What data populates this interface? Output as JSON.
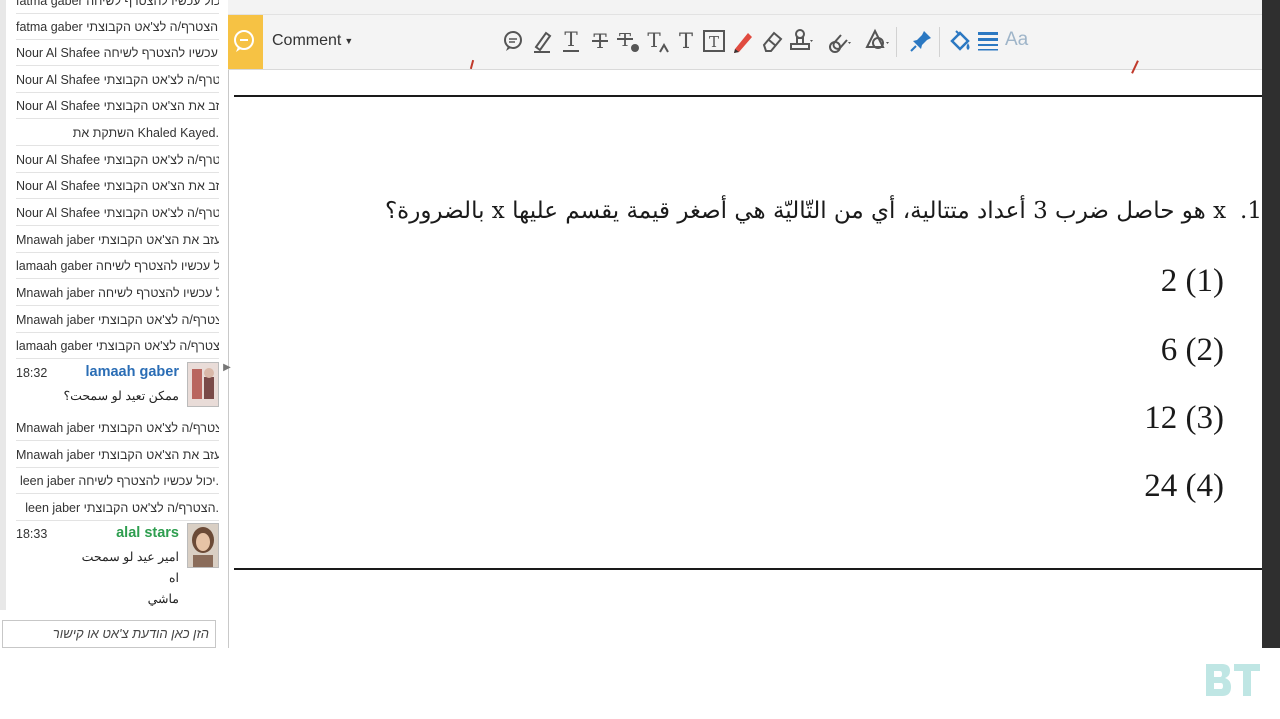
{
  "chat": {
    "top_partial": "fatma gaber יכול עכשיו להצטרף לשיחה.",
    "system_messages_1": [
      "fatma gaber הצטרף/ה לצ'אט הקבוצתי.",
      "Nour Al Shafee יכול עכשיו להצטרף לשיחה.",
      "Nour Al Shafee הצטרף/ה לצ'אט הקבוצתי.",
      "Nour Al Shafee עזב את הצ'אט הקבוצתי.",
      "השתקת את Khaled Kayed.",
      "Nour Al Shafee הצטרף/ה לצ'אט הקבוצתי.",
      "Nour Al Shafee עזב את הצ'אט הקבוצתי.",
      "Nour Al Shafee הצטרף/ה לצ'אט הקבוצתי.",
      "Mnawah jaber עזב את הצ'אט הקבוצתי.",
      "lamaah gaber יכול עכשיו להצטרף לשיחה.",
      "Mnawah jaber יכול עכשיו להצטרף לשיחה.",
      "Mnawah jaber הצטרף/ה לצ'אט הקבוצתי.",
      "lamaah gaber הצטרף/ה לצ'אט הקבוצתי."
    ],
    "user_message_1": {
      "time": "18:32",
      "name": "lamaah gaber",
      "text": "ممكن تعيد لو سمحت؟",
      "name_color": "#2a6db5"
    },
    "system_messages_2": [
      "Mnawah jaber הצטרף/ה לצ'אט הקבוצתי.",
      "Mnawah jaber עזב את הצ'אט הקבוצתי.",
      "leen jaber יכול עכשיו להצטרף לשיחה.",
      "leen jaber הצטרף/ה לצ'אט הקבוצתי."
    ],
    "user_message_2": {
      "time": "18:33",
      "name": "alal stars",
      "text": "امير عيد لو سمحت\nاه\nماشي",
      "name_color": "#2e9e4f"
    },
    "input_placeholder": "הזן כאן הודעת צ'אט או קישור"
  },
  "toolbar": {
    "comment_label": "Comment",
    "accent_color": "#f6c244",
    "tools": [
      "speech-bubble-icon",
      "highlight-pen-icon",
      "underline-text-icon",
      "strikethrough-text-icon",
      "replace-text-icon",
      "insert-text-icon",
      "text-box-icon",
      "framed-text-icon",
      "pencil-icon",
      "eraser-icon",
      "stamp-icon",
      "attach-file-icon",
      "shapes-icon",
      "pin-icon",
      "fill-bucket-icon",
      "lines-icon"
    ],
    "aa_label": "Aa"
  },
  "document": {
    "question_number": "1.",
    "question_text": "x هو حاصل ضرب 3 أعداد متتالية، أي من التّاليّة هي أصغر قيمة يقسم عليها x بالضرورة؟",
    "options": [
      {
        "num": "(1)",
        "value": "2"
      },
      {
        "num": "(2)",
        "value": "6"
      },
      {
        "num": "(3)",
        "value": "12"
      },
      {
        "num": "(4)",
        "value": "24"
      }
    ]
  }
}
